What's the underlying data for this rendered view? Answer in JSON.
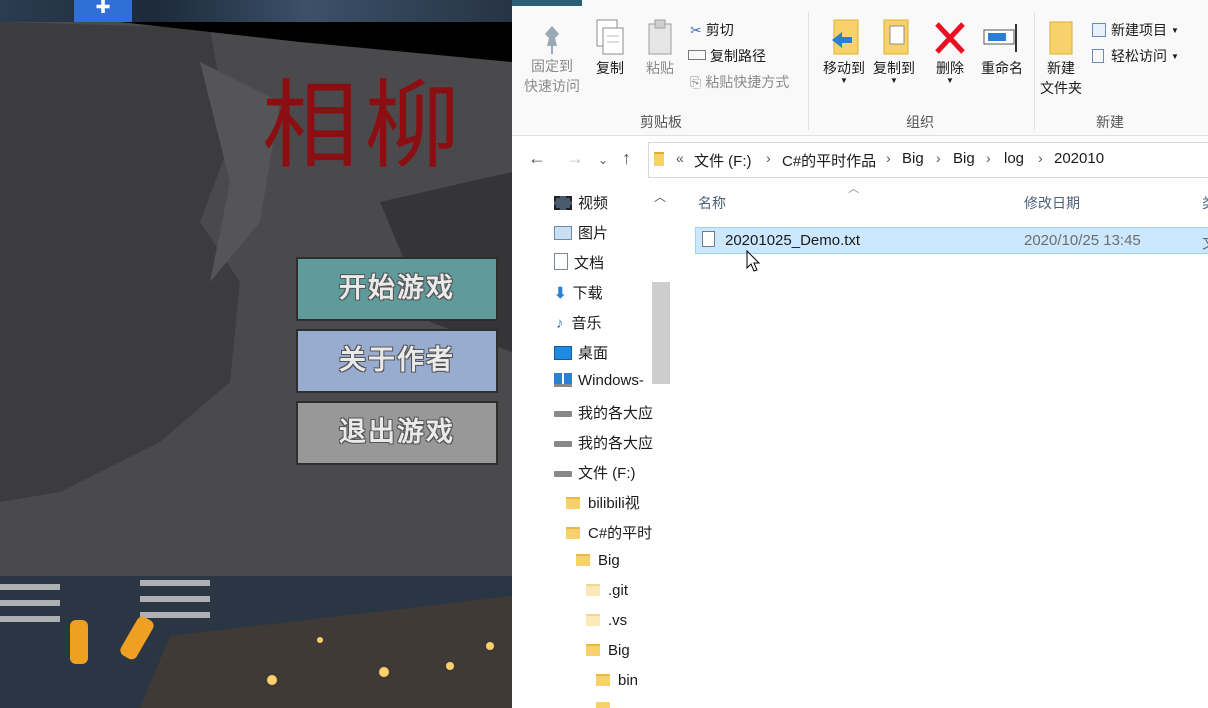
{
  "game": {
    "title_chars": "相柳",
    "buttons": {
      "start": "开始游戏",
      "about": "关于作者",
      "exit": "退出游戏"
    },
    "taskbar_icon": "pin-icon"
  },
  "ribbon": {
    "clipboard": {
      "pin_quick_access_line1": "固定到",
      "pin_quick_access_line2": "快速访问",
      "copy": "复制",
      "paste": "粘贴",
      "cut": "剪切",
      "copy_path": "复制路径",
      "paste_shortcut": "粘贴快捷方式",
      "group_label": "剪贴板"
    },
    "organize": {
      "move_to": "移动到",
      "copy_to": "复制到",
      "delete": "删除",
      "rename": "重命名",
      "group_label": "组织"
    },
    "new": {
      "new_folder_line1": "新建",
      "new_folder_line2": "文件夹",
      "new_item": "新建项目",
      "easy_access": "轻松访问",
      "group_label": "新建"
    }
  },
  "address": {
    "overflow": "«",
    "crumbs": [
      "文件 (F:)",
      "C#的平时作品",
      "Big",
      "Big",
      "log",
      "202010"
    ]
  },
  "nav": {
    "items": [
      {
        "label": "视频",
        "icon": "video-icon"
      },
      {
        "label": "图片",
        "icon": "pictures-icon"
      },
      {
        "label": "文档",
        "icon": "documents-icon"
      },
      {
        "label": "下载",
        "icon": "download-icon"
      },
      {
        "label": "音乐",
        "icon": "music-icon"
      },
      {
        "label": "桌面",
        "icon": "desktop-icon"
      },
      {
        "label": "Windows-",
        "icon": "windows-drive-icon"
      },
      {
        "label": "我的各大应",
        "icon": "drive-icon"
      },
      {
        "label": "我的各大应",
        "icon": "drive-icon"
      },
      {
        "label": "文件  (F:)",
        "icon": "drive-icon"
      },
      {
        "label": "bilibili视",
        "icon": "folder-icon"
      },
      {
        "label": "C#的平时",
        "icon": "folder-icon"
      },
      {
        "label": "Big",
        "icon": "folder-icon"
      },
      {
        "label": ".git",
        "icon": "folder-icon"
      },
      {
        "label": ".vs",
        "icon": "folder-icon"
      },
      {
        "label": "Big",
        "icon": "folder-icon"
      },
      {
        "label": "bin",
        "icon": "folder-icon"
      }
    ]
  },
  "list": {
    "columns": {
      "name": "名称",
      "modified": "修改日期",
      "type": "类"
    },
    "rows": [
      {
        "name": "20201025_Demo.txt",
        "modified": "2020/10/25 13:45",
        "type": "文"
      }
    ]
  },
  "colors": {
    "selection": "#cce8ff",
    "accent": "#2f6fd6",
    "delete_red": "#e81123",
    "title_red": "#8b0f12"
  }
}
